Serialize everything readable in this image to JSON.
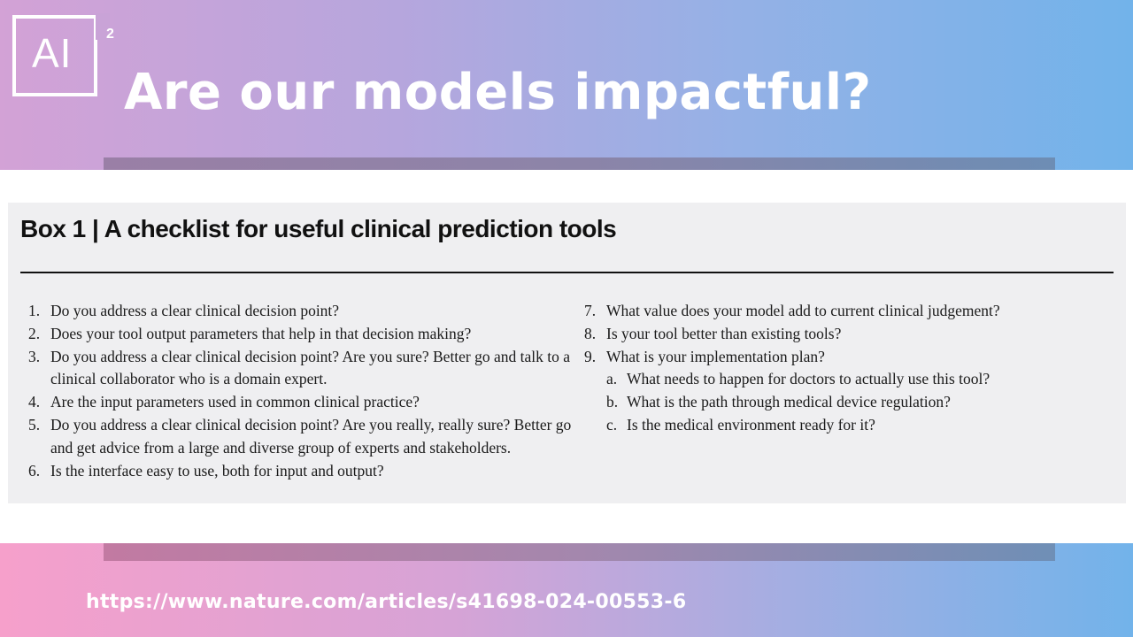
{
  "logo": {
    "text": "AI",
    "superscript": "2"
  },
  "slide_title": "Are our models impactful?",
  "box": {
    "title": "Box 1 | A checklist for useful clinical prediction tools",
    "left_items": [
      {
        "num": "1.",
        "text": "Do you address a clear clinical decision point?"
      },
      {
        "num": "2.",
        "text": "Does your tool output parameters that help in that decision making?"
      },
      {
        "num": "3.",
        "text": "Do you address a clear clinical decision point? Are you sure? Better go and talk to a clinical collaborator who is a domain expert."
      },
      {
        "num": "4.",
        "text": "Are the input parameters used in common clinical practice?"
      },
      {
        "num": "5.",
        "text": "Do you address a clear clinical decision point? Are you really, really sure? Better go and get advice from a large and diverse group of experts and stakeholders."
      },
      {
        "num": "6.",
        "text": "Is the interface easy to use, both for input and output?"
      }
    ],
    "right_items": [
      {
        "num": "7.",
        "text": "What value does your model add to current clinical judgement?"
      },
      {
        "num": "8.",
        "text": "Is your tool better than existing tools?"
      },
      {
        "num": "9.",
        "text": "What is your implementation plan?"
      }
    ],
    "sub_items": [
      {
        "letter": "a.",
        "text": "What needs to happen for doctors to actually use this tool?"
      },
      {
        "letter": "b.",
        "text": "What is the path through medical device regulation?"
      },
      {
        "letter": "c.",
        "text": "Is the medical environment ready for it?"
      }
    ]
  },
  "source_url": "https://www.nature.com/articles/s41698-024-00553-6"
}
